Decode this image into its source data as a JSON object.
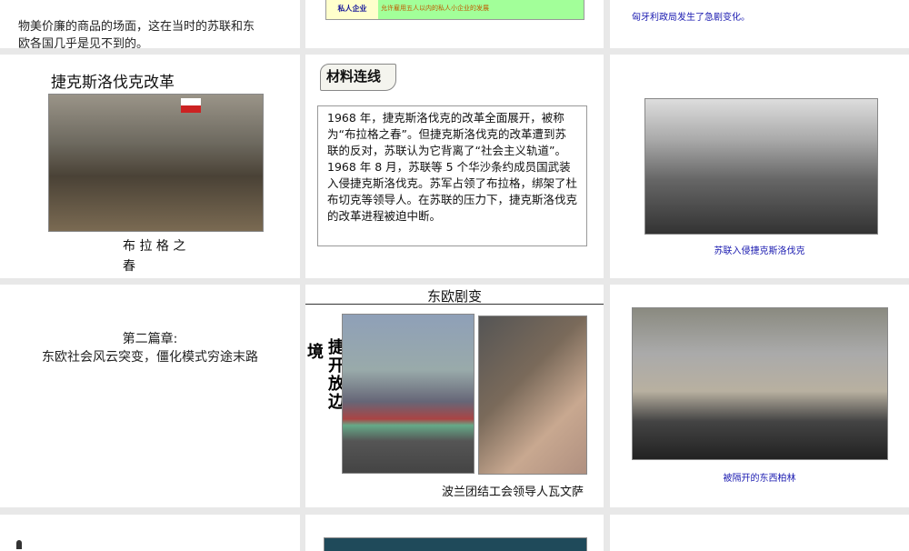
{
  "slides": [
    {
      "lines": [
        "物美价廉的商品的场面，这在当时的苏联和东",
        "欧各国几乎是见不到的。"
      ]
    },
    {
      "row_label": "私人企业",
      "row_text": "允许雇用五人以内的私人小企业的发展"
    },
    {
      "caption": "匈牙利政局发生了急剧变化。"
    },
    {
      "title": "捷克斯洛伐克改革",
      "caption_line1": "布 拉 格 之",
      "caption_line2": "春"
    },
    {
      "badge": "材料连线",
      "body": "1968 年，捷克斯洛伐克的改革全面展开，被称为“布拉格之春”。但捷克斯洛伐克的改革遭到苏联的反对，苏联认为它背离了“社会主义轨道”。 1968 年 8 月，苏联等 5 个华沙条约成员国武装入侵捷克斯洛伐克。苏军占领了布拉格，绑架了杜布切克等领导人。在苏联的压力下，捷克斯洛伐克的改革进程被迫中断。"
    },
    {
      "caption": "苏联入侵捷克斯洛伐克"
    },
    {
      "line1": "第二篇章:",
      "line2": "东欧社会风云突变，僵化模式穷途末路"
    },
    {
      "title": "东欧剧变",
      "side_a": "境",
      "side_b": "捷开放边",
      "caption": "波兰团结工会领导人瓦文萨"
    },
    {
      "caption": "被隔开的东西柏林"
    }
  ]
}
